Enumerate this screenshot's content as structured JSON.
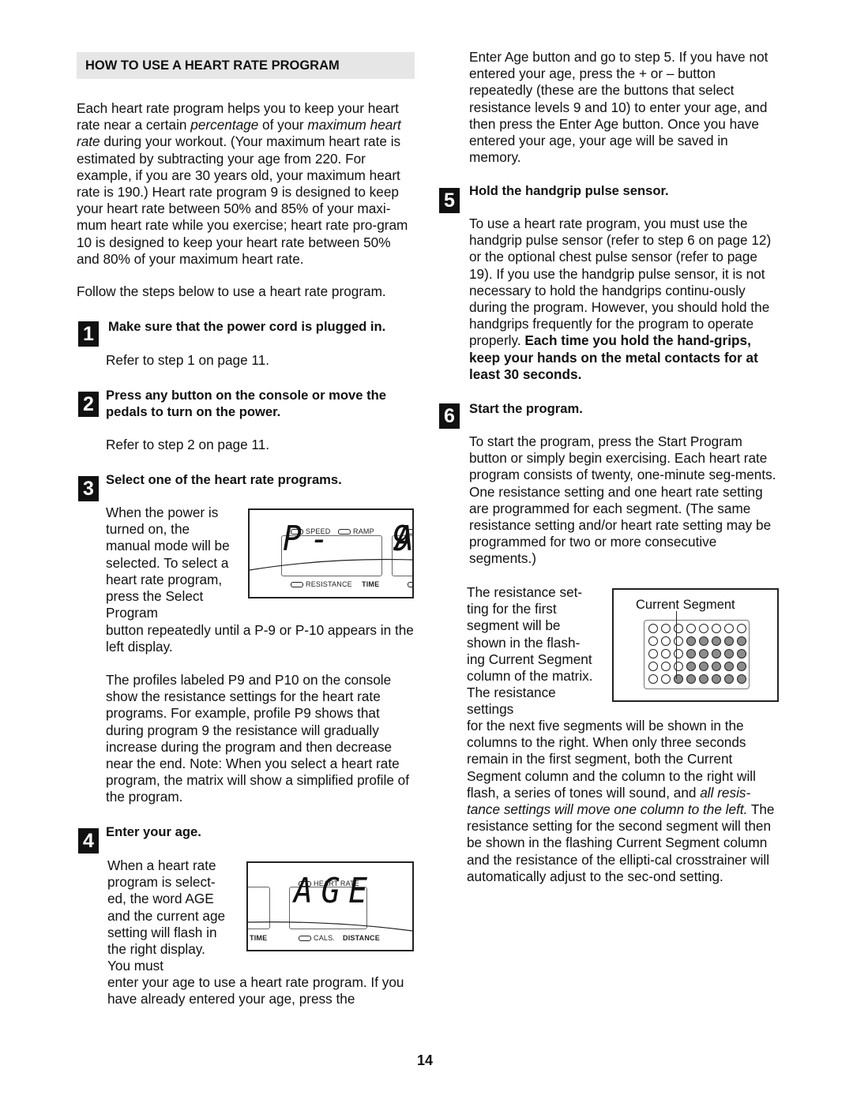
{
  "section_heading": "HOW TO USE A HEART RATE PROGRAM",
  "intro": {
    "p1_parts": [
      {
        "t": "Each heart rate program helps you to keep your heart rate near a certain ",
        "s": "normal"
      },
      {
        "t": "percentage",
        "s": "italic"
      },
      {
        "t": " of your ",
        "s": "normal"
      },
      {
        "t": "maximum heart rate",
        "s": "italic"
      },
      {
        "t": " during your workout. (Your maximum heart rate is estimated by subtracting your age from 220. For example, if you are 30 years old, your maximum heart rate is 190.) Heart rate program 9 is designed to keep your heart rate between 50% and 85% of your maxi-mum heart rate while you exercise; heart rate pro-gram 10 is designed to keep your heart rate between 50% and 80% of your maximum heart rate.",
        "s": "normal"
      }
    ],
    "p2": "Follow the steps below to use a heart rate program."
  },
  "steps": [
    {
      "number": "1",
      "title": "Make sure that the power cord is plugged in.",
      "body": "Refer to step 1 on page 11."
    },
    {
      "number": "2",
      "title": "Press any button on the console or move the pedals to turn on the power.",
      "body": "Refer to step 2 on page 11."
    },
    {
      "number": "3",
      "title": "Select one of the heart rate programs.",
      "body_wrap": "When the power is turned on, the manual mode will be selected. To select a heart rate program, press the Select Program",
      "body_full": "button repeatedly until a P-9 or P-10 appears in the left display.",
      "body2": "The profiles labeled P9 and P10 on the console show the resistance settings for the heart rate programs. For example, profile P9 shows that during program 9 the resistance will gradually increase during the program and then decrease near the end. Note: When you select a heart rate program, the matrix will show a simplified profile of the program."
    },
    {
      "number": "4",
      "title": "Enter your age.",
      "body_wrap": "When a heart rate program is select-ed, the word AGE and the current age setting will flash in the right display. You must",
      "body_full": "enter your age to use a heart rate program. If you have already entered your age, press the",
      "body_cont": "Enter Age button and go to step 5. If you have not entered your age, press the + or – button repeatedly (these are the buttons that select resistance levels 9 and 10) to enter your age, and then press the Enter Age button. Once you have entered your age, your age will be saved in memory."
    },
    {
      "number": "5",
      "title": "Hold the handgrip pulse sensor.",
      "body_normal": "To use a heart rate program, you must use the handgrip pulse sensor (refer to step 6 on page 12) or the optional chest pulse sensor (refer to page 19). If you use the handgrip pulse sensor, it is not necessary to hold the handgrips continu-ously during the program. However, you should hold the handgrips frequently for the program to operate properly. ",
      "body_bold": "Each time you hold the hand-grips, keep your hands on the metal contacts for at least 30 seconds."
    },
    {
      "number": "6",
      "title": "Start the program.",
      "body": "To start the program, press the Start Program button or simply begin exercising. Each heart rate program consists of twenty, one-minute seg-ments. One resistance setting and one heart rate setting are programmed for each segment. (The same resistance setting and/or heart rate setting may be programmed for two or more consecutive segments.)",
      "body_wrap": "The resistance set-ting for the first segment will be shown in the flash-ing Current Segment column of the matrix. The resistance settings",
      "body_full_a": "for the next five segments will be shown in the columns to the right. When only three seconds remain in the first segment, both the Current Segment column and the column to the right will flash, a series of tones will sound, and ",
      "body_full_italic": "all resis-tance settings will move one column to the left.",
      "body_full_b": " The resistance setting for the second segment will then be shown in the flashing Current Segment column and the resistance of the ellipti-cal crosstrainer will automatically adjust to the sec-ond setting."
    }
  ],
  "console_program": {
    "labels_top": [
      "SPEED",
      "RAMP"
    ],
    "label_bottom_led": "RESISTANCE",
    "label_bottom_bold": "TIME",
    "display_text": "P-  9"
  },
  "console_age": {
    "label_top": "HEART RATE",
    "label_left_bold": "TIME",
    "label_bottom_led": "CALS.",
    "label_bottom_bold": "DISTANCE",
    "display_text": "AGE"
  },
  "matrix": {
    "title": "Current Segment",
    "rows": 5,
    "cols": 8,
    "current_column": 3,
    "filled": [
      [
        0,
        0,
        0,
        0,
        0,
        0,
        0,
        0
      ],
      [
        0,
        0,
        0,
        1,
        1,
        1,
        1,
        1
      ],
      [
        0,
        0,
        0,
        1,
        1,
        1,
        1,
        1
      ],
      [
        0,
        0,
        0,
        1,
        1,
        1,
        1,
        1
      ],
      [
        0,
        0,
        1,
        1,
        1,
        1,
        1,
        1
      ]
    ]
  },
  "page_number": "14"
}
